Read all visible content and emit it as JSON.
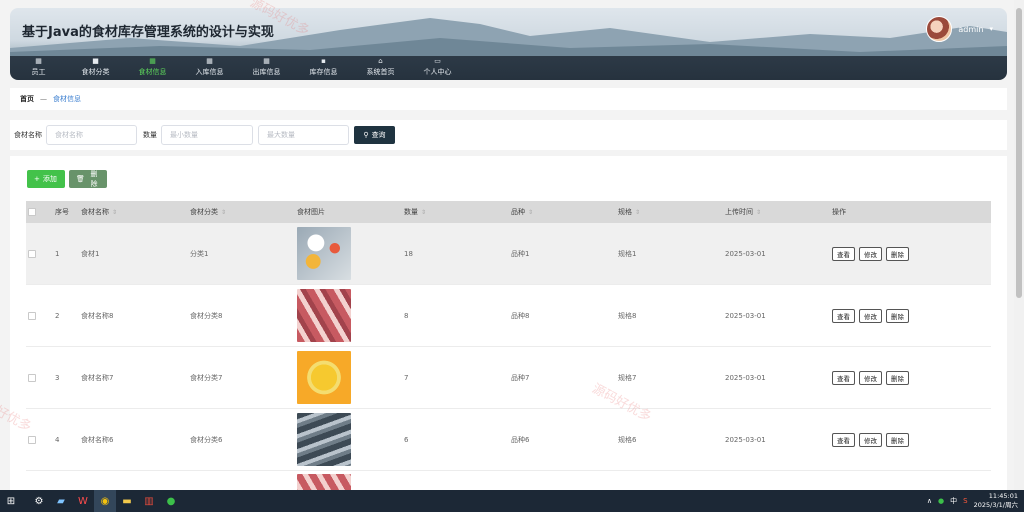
{
  "header": {
    "title": "基于Java的食材库存管理系统的设计与实现",
    "username": "admin"
  },
  "nav": [
    {
      "label": "员工",
      "icon": "grid-icon"
    },
    {
      "label": "食材分类",
      "icon": "square-icon"
    },
    {
      "label": "食材信息",
      "icon": "grid-icon",
      "active": true
    },
    {
      "label": "入库信息",
      "icon": "grid-icon"
    },
    {
      "label": "出库信息",
      "icon": "grid-icon"
    },
    {
      "label": "库存信息",
      "icon": "chat-icon"
    },
    {
      "label": "系统首页",
      "icon": "home-icon"
    },
    {
      "label": "个人中心",
      "icon": "card-icon"
    }
  ],
  "breadcrumb": {
    "home": "首页",
    "separator": "—",
    "current": "食材信息"
  },
  "search": {
    "name_label": "食材名称",
    "name_placeholder": "食材名称",
    "qty_label": "数量",
    "min_placeholder": "最小数量",
    "max_placeholder": "最大数量",
    "button_label": "查询"
  },
  "toolbar": {
    "add_label": "添加",
    "delete_label": "删除"
  },
  "table": {
    "headers": [
      "序号",
      "食材名称",
      "食材分类",
      "食材图片",
      "数量",
      "品种",
      "规格",
      "上传时间",
      "操作"
    ],
    "rows": [
      {
        "index": "1",
        "name": "食材1",
        "category": "分类1",
        "qty": "18",
        "variety": "品种1",
        "spec": "规格1",
        "date": "2025-03-01"
      },
      {
        "index": "2",
        "name": "食材名称8",
        "category": "食材分类8",
        "qty": "8",
        "variety": "品种8",
        "spec": "规格8",
        "date": "2025-03-01"
      },
      {
        "index": "3",
        "name": "食材名称7",
        "category": "食材分类7",
        "qty": "7",
        "variety": "品种7",
        "spec": "规格7",
        "date": "2025-03-01"
      },
      {
        "index": "4",
        "name": "食材名称6",
        "category": "食材分类6",
        "qty": "6",
        "variety": "品种6",
        "spec": "规格6",
        "date": "2025-03-01"
      }
    ],
    "op_view": "查看",
    "op_edit": "修改",
    "op_delete": "删除"
  },
  "watermark": "源码好优多",
  "taskbar": {
    "ime": "中",
    "time": "11:45:01",
    "date": "2025/3/1/周六"
  }
}
